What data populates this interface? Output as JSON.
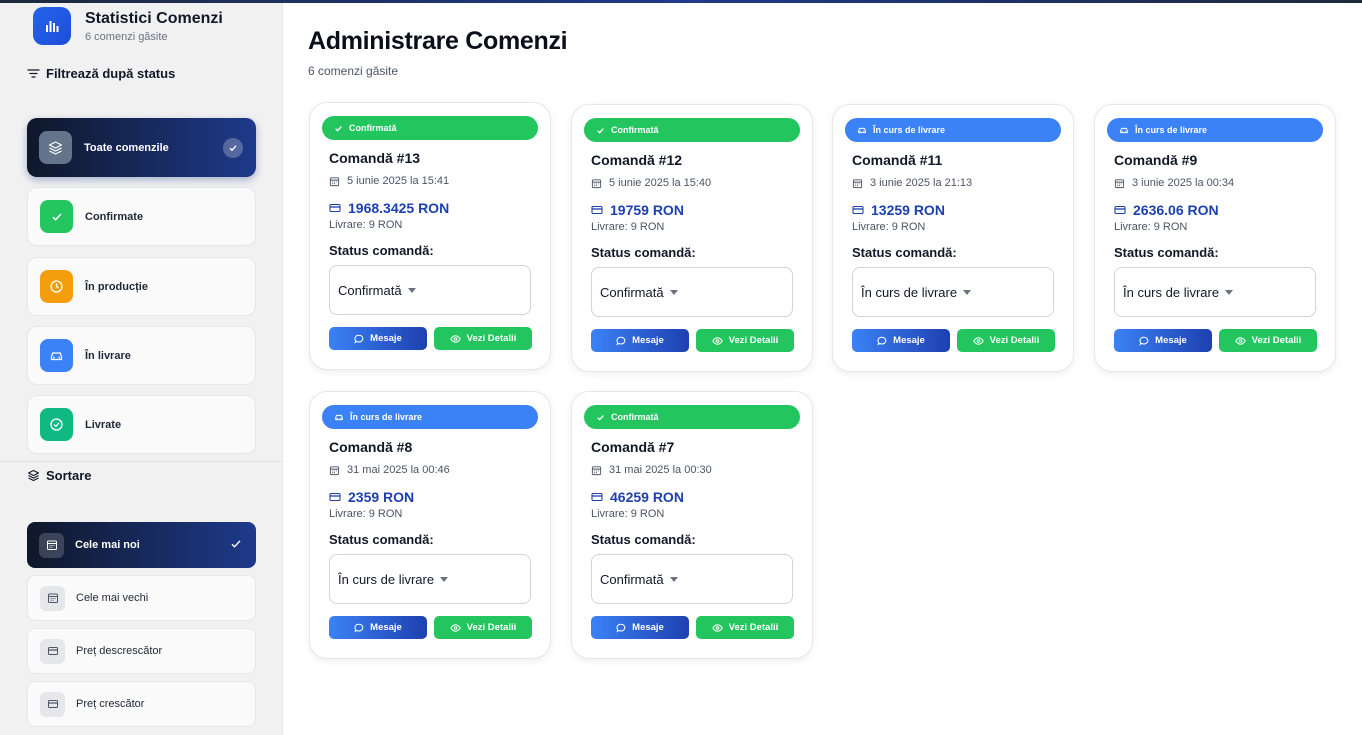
{
  "sidebar": {
    "title": "Statistici Comenzi",
    "subtitle": "6 comenzi găsite",
    "filter_title": "Filtrează după status",
    "filters": [
      {
        "label": "Toate comenzile",
        "icon": "layers-icon",
        "color": "#64748b"
      },
      {
        "label": "Confirmate",
        "icon": "check-icon",
        "color": "#22c55e"
      },
      {
        "label": "În producție",
        "icon": "clock-icon",
        "color": "#f59e0b"
      },
      {
        "label": "În livrare",
        "icon": "car-icon",
        "color": "#3b82f6"
      },
      {
        "label": "Livrate",
        "icon": "check-circle-icon",
        "color": "#10b981"
      }
    ],
    "sort_title": "Sortare",
    "sorts": [
      {
        "label": "Cele mai noi",
        "icon": "calendar-icon"
      },
      {
        "label": "Cele mai vechi",
        "icon": "calendar-icon"
      },
      {
        "label": "Preț descrescător",
        "icon": "credit-card-icon"
      },
      {
        "label": "Preț crescător",
        "icon": "credit-card-icon"
      }
    ]
  },
  "main": {
    "title": "Administrare Comenzi",
    "subtitle": "6 comenzi găsite"
  },
  "orders": [
    {
      "badge": "Confirmată",
      "badge_color": "#22c55e",
      "title": "Comandă #13",
      "date": "5 iunie 2025 la 15:41",
      "price": "1968.3425 RON",
      "delivery": "Livrare: 9 RON",
      "status_label": "Status comandă:",
      "status": "Confirmată",
      "msg": "Mesaje",
      "details": "Vezi Detalii"
    },
    {
      "badge": "Confirmată",
      "badge_color": "#22c55e",
      "title": "Comandă #12",
      "date": "5 iunie 2025 la 15:40",
      "price": "19759 RON",
      "delivery": "Livrare: 9 RON",
      "status_label": "Status comandă:",
      "status": "Confirmată",
      "msg": "Mesaje",
      "details": "Vezi Detalii"
    },
    {
      "badge": "În curs de livrare",
      "badge_color": "#3b82f6",
      "title": "Comandă #11",
      "date": "3 iunie 2025 la 21:13",
      "price": "13259 RON",
      "delivery": "Livrare: 9 RON",
      "status_label": "Status comandă:",
      "status": "În curs de livrare",
      "msg": "Mesaje",
      "details": "Vezi Detalii"
    },
    {
      "badge": "În curs de livrare",
      "badge_color": "#3b82f6",
      "title": "Comandă #9",
      "date": "3 iunie 2025 la 00:34",
      "price": "2636.06 RON",
      "delivery": "Livrare: 9 RON",
      "status_label": "Status comandă:",
      "status": "În curs de livrare",
      "msg": "Mesaje",
      "details": "Vezi Detalii"
    },
    {
      "badge": "În curs de livrare",
      "badge_color": "#3b82f6",
      "title": "Comandă #8",
      "date": "31 mai 2025 la 00:46",
      "price": "2359 RON",
      "delivery": "Livrare: 9 RON",
      "status_label": "Status comandă:",
      "status": "În curs de livrare",
      "msg": "Mesaje",
      "details": "Vezi Detalii"
    },
    {
      "badge": "Confirmată",
      "badge_color": "#22c55e",
      "title": "Comandă #7",
      "date": "31 mai 2025 la 00:30",
      "price": "46259 RON",
      "delivery": "Livrare: 9 RON",
      "status_label": "Status comandă:",
      "status": "Confirmată",
      "msg": "Mesaje",
      "details": "Vezi Detalii"
    }
  ]
}
